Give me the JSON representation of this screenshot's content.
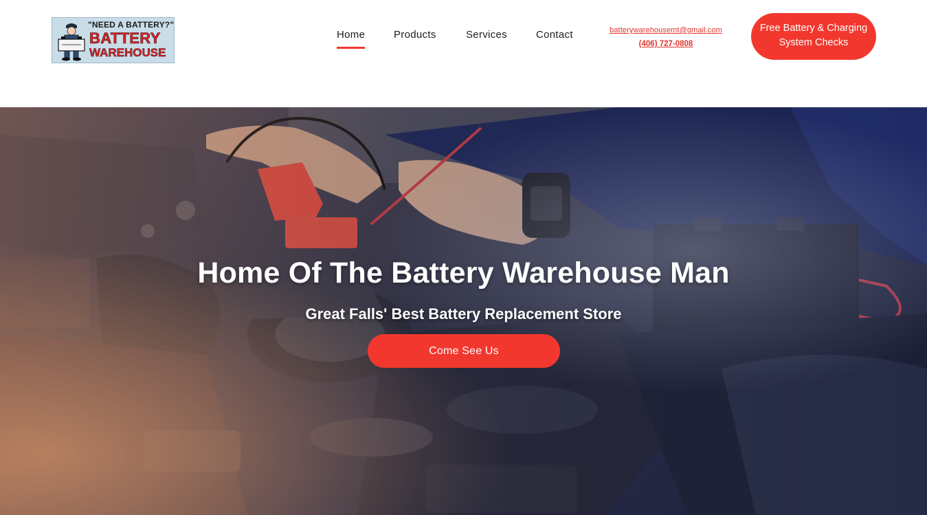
{
  "logo": {
    "tagline": "\"NEED A BATTERY?\"",
    "brand_line1": "BATTERY",
    "brand_line2": "WAREHOUSE"
  },
  "nav": {
    "items": [
      {
        "label": "Home",
        "active": true
      },
      {
        "label": "Products",
        "active": false
      },
      {
        "label": "Services",
        "active": false
      },
      {
        "label": "Contact",
        "active": false
      }
    ]
  },
  "contact": {
    "email": "batterywarehousemt@gmail.com",
    "phone": "(406) 727-0808"
  },
  "header_cta": {
    "line1": "Free Battery & Charging",
    "line2": "System Checks"
  },
  "hero": {
    "title": "Home Of The Battery Warehouse Man",
    "subtitle": "Great Falls' Best Battery Replacement Store",
    "cta_label": "Come See Us"
  },
  "colors": {
    "accent": "#f2382e",
    "nav_text": "#1c1c1c",
    "link": "#e0362c"
  }
}
